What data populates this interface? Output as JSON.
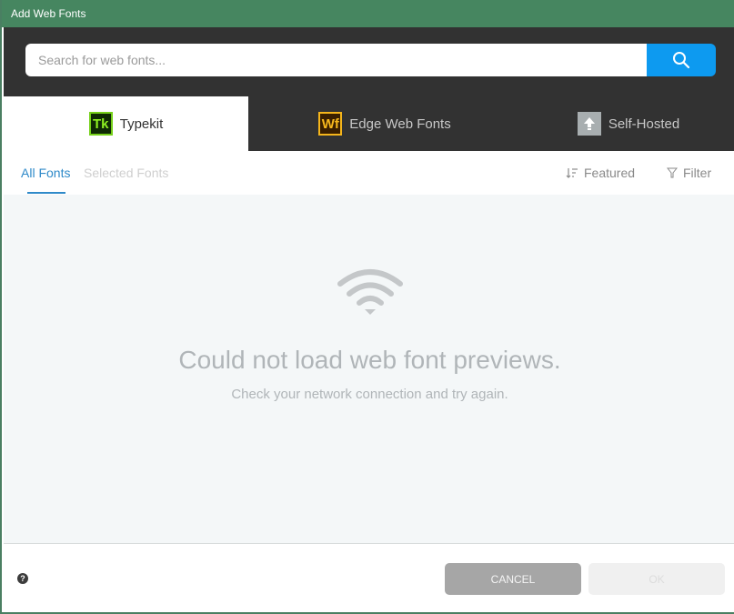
{
  "window": {
    "title": "Add Web Fonts"
  },
  "search": {
    "placeholder": "Search for web fonts...",
    "value": "",
    "button_icon": "search-icon"
  },
  "tabs": [
    {
      "label": "Typekit",
      "badge": "Tk",
      "icon": "typekit-icon",
      "active": true
    },
    {
      "label": "Edge Web Fonts",
      "badge": "Wf",
      "icon": "edge-web-fonts-icon",
      "active": false
    },
    {
      "label": "Self-Hosted",
      "badge": "",
      "icon": "upload-icon",
      "active": false
    }
  ],
  "subnav": {
    "tabs": [
      {
        "label": "All Fonts",
        "active": true
      },
      {
        "label": "Selected Fonts",
        "active": false
      }
    ],
    "sort_label": "Featured",
    "filter_label": "Filter"
  },
  "message": {
    "icon": "wifi-icon",
    "title": "Could not load web font previews.",
    "subtitle": "Check your network connection and try again."
  },
  "footer": {
    "help_icon": "help-icon",
    "cancel_label": "CANCEL",
    "ok_label": "OK"
  },
  "colors": {
    "titlebar": "#468660",
    "accent": "#0d9af0",
    "active_tab": "#2f8ac9",
    "dark_band": "#323232"
  }
}
